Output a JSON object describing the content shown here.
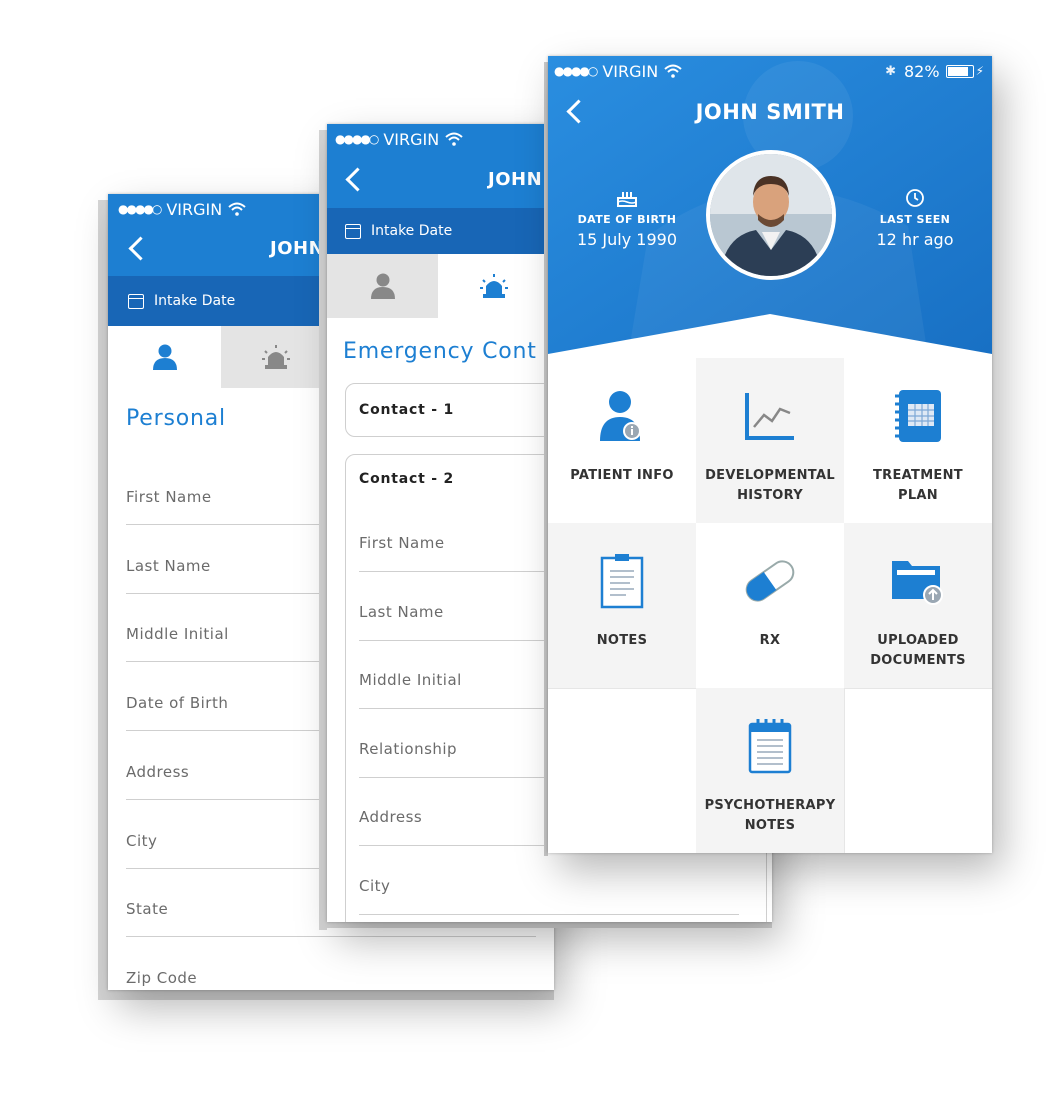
{
  "status_bar": {
    "carrier": "VIRGIN",
    "battery_percent": "82%"
  },
  "screen_personal": {
    "title": "JOHN",
    "intake_label": "Intake Date",
    "section_title": "Personal",
    "fields": [
      "First Name",
      "Last Name",
      "Middle Initial",
      "Date of Birth",
      "Address",
      "City",
      "State",
      "Zip Code"
    ]
  },
  "screen_emergency": {
    "title": "JOHN",
    "intake_label": "Intake Date",
    "section_title": "Emergency Cont",
    "contact1_title": "Contact - 1",
    "contact2_title": "Contact - 2",
    "fields": [
      "First Name",
      "Last Name",
      "Middle Initial",
      "Relationship",
      "Address",
      "City"
    ]
  },
  "screen_profile": {
    "patient_name": "JOHN SMITH",
    "dob_label": "DATE OF BIRTH",
    "dob_value": "15 July 1990",
    "last_seen_label": "LAST SEEN",
    "last_seen_value": "12 hr ago",
    "menu": [
      {
        "line1": "PATIENT INFO",
        "line2": "",
        "icon": "patient-info-icon"
      },
      {
        "line1": "DEVELOPMENTAL",
        "line2": "HISTORY",
        "icon": "chart-icon"
      },
      {
        "line1": "TREATMENT",
        "line2": "PLAN",
        "icon": "planner-icon"
      },
      {
        "line1": "NOTES",
        "line2": "",
        "icon": "clipboard-icon"
      },
      {
        "line1": "RX",
        "line2": "",
        "icon": "pill-icon"
      },
      {
        "line1": "UPLOADED",
        "line2": "DOCUMENTS",
        "icon": "folder-upload-icon"
      },
      {
        "line1": "PSYCHOTHERAPY",
        "line2": "NOTES",
        "icon": "notepad-icon"
      }
    ]
  },
  "colors": {
    "primary_blue": "#1d7fd2",
    "dark_blue": "#1866b6",
    "tab_gray": "#e4e4e4"
  }
}
